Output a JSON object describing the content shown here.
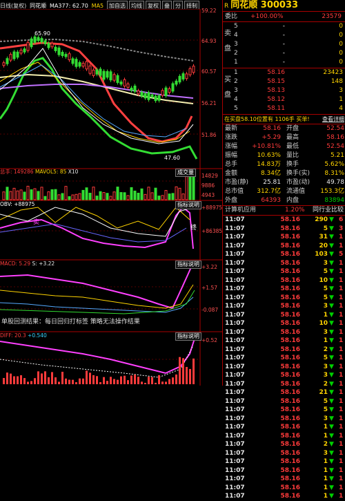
{
  "toolbar": {
    "day_label": "日线(复权)",
    "stock_name": "同花顺",
    "ma_label": "MA377: 62.70",
    "ma_extra": "MA5",
    "buttons": [
      "加自选",
      "均线",
      "复权",
      "叠",
      "分",
      "择制"
    ]
  },
  "price_axis": [
    "59.22",
    "64.93",
    "60.57",
    "56.21",
    "51.86"
  ],
  "annotations": {
    "high": "65.90",
    "low": "47.60",
    "candle_count": "19"
  },
  "volume_panel": {
    "header": "总手: 149286",
    "header_ma": "MAVOL5: 85",
    "header_unit": "X10",
    "index_button": "成交量",
    "axis": [
      "14829",
      "9886",
      "4943"
    ]
  },
  "obv_panel": {
    "header": "OBV: +88975",
    "index_button": "指标说明",
    "axis": [
      "+88975",
      "+86385"
    ],
    "note1": "卖",
    "note2": "终"
  },
  "macd_panel": {
    "header": "MACD: 5.29",
    "header2": "S: +3.22",
    "index_button": "指标说明",
    "axis": [
      "+3.22",
      "+1.57",
      "-0.087"
    ]
  },
  "fifth_panel": {
    "header": "DIFF: 20.3",
    "header2": "+0.540",
    "index_button": "指标说明",
    "axis": [
      "+0.52"
    ]
  },
  "overlay_text": "单股回测结果：每日回归打标签  策略无法操作结果",
  "quote": {
    "title_prefix": "R",
    "title": "同花顺 300033",
    "ratio_label": "委比",
    "ratio_value": "+100.00%",
    "ratio_diff": "23579",
    "sell_side_label": [
      "卖",
      "盘"
    ],
    "buy_side_label": [
      "买",
      "盘"
    ],
    "sell": [
      {
        "level": "5",
        "price": "-",
        "vol": "0"
      },
      {
        "level": "4",
        "price": "-",
        "vol": "0"
      },
      {
        "level": "3",
        "price": "-",
        "vol": "0"
      },
      {
        "level": "2",
        "price": "-",
        "vol": "0"
      },
      {
        "level": "1",
        "price": "-",
        "vol": "0"
      }
    ],
    "buy": [
      {
        "level": "1",
        "price": "58.16",
        "vol": "23423"
      },
      {
        "level": "2",
        "price": "58.15",
        "vol": "148"
      },
      {
        "level": "3",
        "price": "58.13",
        "vol": "3"
      },
      {
        "level": "4",
        "price": "58.12",
        "vol": "1"
      },
      {
        "level": "5",
        "price": "58.11",
        "vol": "4"
      }
    ],
    "status_line": "在买盘58.10位置有  1106手 买单!",
    "status_link": "查看详细",
    "stats": [
      [
        "最新",
        "58.16",
        "red",
        "开盘",
        "52.54",
        "red"
      ],
      [
        "涨跌",
        "+5.29",
        "red",
        "最高",
        "58.16",
        "red"
      ],
      [
        "涨幅",
        "+10.81%",
        "red",
        "最低",
        "52.54",
        "red"
      ],
      [
        "振幅",
        "10.63%",
        "yel",
        "量比",
        "5.21",
        "yel"
      ],
      [
        "总手",
        "14.83万",
        "yel",
        "换手",
        "5.62%",
        "yel"
      ],
      [
        "金额",
        "8.34亿",
        "yel",
        "换手(实)",
        "8.31%",
        "yel"
      ],
      [
        "市盈(静)",
        "25.81",
        "wht",
        "市盈(动)",
        "49.78",
        "wht"
      ],
      [
        "总市值",
        "312.7亿",
        "yel",
        "流通值",
        "153.3亿",
        "yel"
      ],
      [
        "外盘",
        "64393",
        "red",
        "内盘",
        "83894",
        "grn"
      ]
    ],
    "calc_label": "计算机应用",
    "calc_value": "1.20%",
    "calc_link": "同行业比较",
    "ticks": [
      {
        "time": "11:07",
        "price": "58.16",
        "vol": "290",
        "dir": "down",
        "n": "6"
      },
      {
        "time": "11:07",
        "price": "58.16",
        "vol": "5",
        "dir": "down",
        "n": "3"
      },
      {
        "time": "11:07",
        "price": "58.16",
        "vol": "31",
        "dir": "down",
        "n": "1"
      },
      {
        "time": "11:07",
        "price": "58.16",
        "vol": "20",
        "dir": "down",
        "n": "1"
      },
      {
        "time": "11:07",
        "price": "58.16",
        "vol": "103",
        "dir": "down",
        "n": "5"
      },
      {
        "time": "11:07",
        "price": "58.16",
        "vol": "3",
        "dir": "down",
        "n": "1"
      },
      {
        "time": "11:07",
        "price": "58.16",
        "vol": "5",
        "dir": "down",
        "n": "1"
      },
      {
        "time": "11:07",
        "price": "58.16",
        "vol": "10",
        "dir": "down",
        "n": "1"
      },
      {
        "time": "11:07",
        "price": "58.16",
        "vol": "5",
        "dir": "down",
        "n": "1"
      },
      {
        "time": "11:07",
        "price": "58.16",
        "vol": "5",
        "dir": "down",
        "n": "1"
      },
      {
        "time": "11:07",
        "price": "58.16",
        "vol": "3",
        "dir": "down",
        "n": "1"
      },
      {
        "time": "11:07",
        "price": "58.16",
        "vol": "1",
        "dir": "down",
        "n": "1"
      },
      {
        "time": "11:07",
        "price": "58.16",
        "vol": "10",
        "dir": "down",
        "n": "1"
      },
      {
        "time": "11:07",
        "price": "58.16",
        "vol": "3",
        "dir": "down",
        "n": "1"
      },
      {
        "time": "11:07",
        "price": "58.16",
        "vol": "1",
        "dir": "down",
        "n": "1"
      },
      {
        "time": "11:07",
        "price": "58.16",
        "vol": "2",
        "dir": "down",
        "n": "1"
      },
      {
        "time": "11:07",
        "price": "58.16",
        "vol": "5",
        "dir": "down",
        "n": "1"
      },
      {
        "time": "11:07",
        "price": "58.16",
        "vol": "3",
        "dir": "down",
        "n": "1"
      },
      {
        "time": "11:07",
        "price": "58.16",
        "vol": "3",
        "dir": "down",
        "n": "1"
      },
      {
        "time": "11:07",
        "price": "58.16",
        "vol": "2",
        "dir": "down",
        "n": "1"
      },
      {
        "time": "11:07",
        "price": "58.16",
        "vol": "21",
        "dir": "down",
        "n": "1"
      },
      {
        "time": "11:07",
        "price": "58.16",
        "vol": "5",
        "dir": "down",
        "n": "1"
      },
      {
        "time": "11:07",
        "price": "58.16",
        "vol": "5",
        "dir": "down",
        "n": "1"
      },
      {
        "time": "11:07",
        "price": "58.16",
        "vol": "3",
        "dir": "down",
        "n": "1"
      },
      {
        "time": "11:07",
        "price": "58.16",
        "vol": "1",
        "dir": "down",
        "n": "1"
      },
      {
        "time": "11:07",
        "price": "58.16",
        "vol": "1",
        "dir": "down",
        "n": "1"
      },
      {
        "time": "11:07",
        "price": "58.16",
        "vol": "2",
        "dir": "down",
        "n": "1"
      },
      {
        "time": "11:07",
        "price": "58.16",
        "vol": "3",
        "dir": "down",
        "n": "1"
      },
      {
        "time": "11:07",
        "price": "58.16",
        "vol": "1",
        "dir": "down",
        "n": "1"
      },
      {
        "time": "11:07",
        "price": "58.16",
        "vol": "1",
        "dir": "down",
        "n": "1"
      },
      {
        "time": "11:07",
        "price": "58.16",
        "vol": "1",
        "dir": "down",
        "n": "1"
      },
      {
        "time": "11:07",
        "price": "58.16",
        "vol": "1",
        "dir": "down",
        "n": "1"
      },
      {
        "time": "11:07",
        "price": "58.16",
        "vol": "1",
        "dir": "down",
        "n": "1"
      }
    ]
  },
  "colors": {
    "up": "#ff3b3b",
    "down": "#00d000",
    "accent": "#ffd400",
    "grid": "#a00000"
  }
}
